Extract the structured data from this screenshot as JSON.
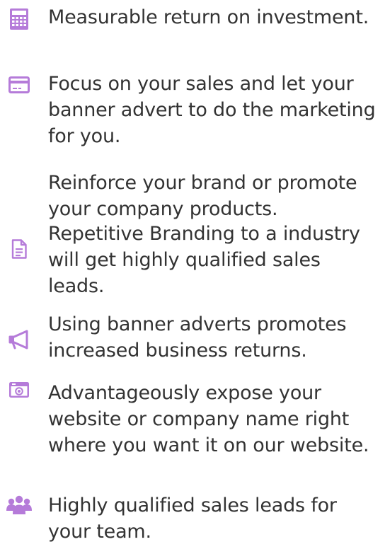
{
  "colors": {
    "icon": "#b57bd9",
    "text": "#333333",
    "background": "#ffffff"
  },
  "features": [
    {
      "icon": "calculator-icon",
      "text": "Measurable return on investment."
    },
    {
      "icon": "credit-card-icon",
      "text": "Focus on your sales and let your banner advert to do the marketing for you."
    },
    {
      "icon": "",
      "text": "Reinforce your brand or promote your company products."
    },
    {
      "icon": "document-icon",
      "text": "Repetitive Branding to a industry will get highly qualified sales leads."
    },
    {
      "icon": "megaphone-icon",
      "text": "Using banner adverts promotes increased business returns."
    },
    {
      "icon": "camera-icon",
      "text": "Advantageously expose your website or company name right where you want it on our website."
    },
    {
      "icon": "users-icon",
      "text": "Highly qualified sales leads for your team."
    }
  ]
}
